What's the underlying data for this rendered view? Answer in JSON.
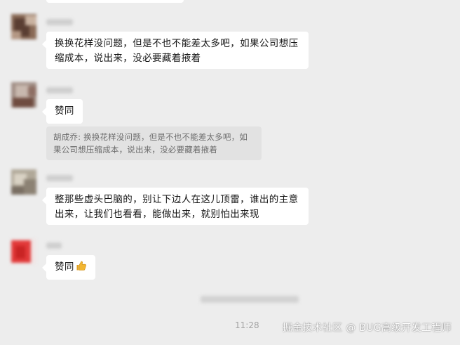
{
  "messages": [
    {
      "text": "换换花样没问题，但是不也不能差太多吧，如果公司想压缩成本，说出来，没必要藏着掖着"
    },
    {
      "text": "赞同"
    },
    {
      "text": "整那些虚头巴脑的，别让下边人在这儿顶雷，谁出的主意出来，让我们也看看，能做出来，就别怕出来现"
    },
    {
      "text": "赞同",
      "icon": "thumbs-up-icon"
    }
  ],
  "quote": {
    "text": "胡成乔: 换换花样没问题，但是不也不能差太多吧，如果公司想压缩成本，说出来，没必要藏着掖着"
  },
  "time": "11:28",
  "watermark": "掘金技术社区 @ BUG高级开发工程师",
  "colors": {
    "background": "#ededed",
    "bubble": "#ffffff",
    "quote": "#e2e2e2",
    "thumb": "#f2b631"
  }
}
